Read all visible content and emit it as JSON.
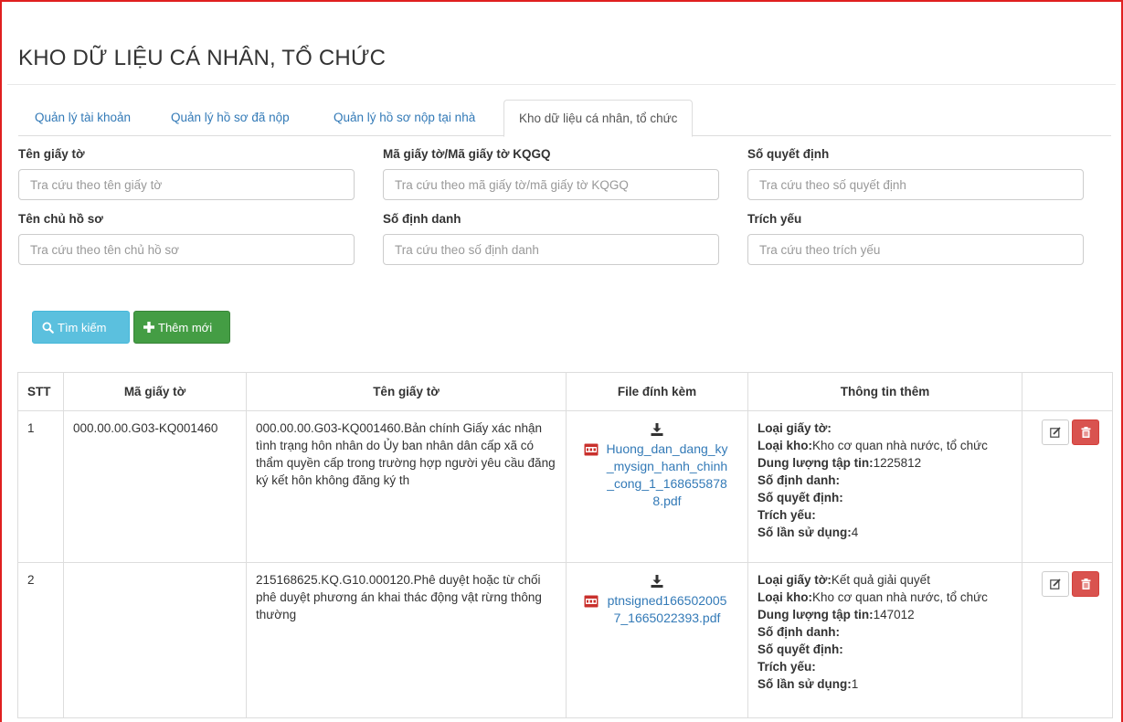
{
  "page": {
    "title": "KHO DỮ LIỆU CÁ NHÂN, TỔ CHỨC"
  },
  "tabs": [
    {
      "label": "Quản lý tài khoản",
      "active": false
    },
    {
      "label": "Quản lý hồ sơ đã nộp",
      "active": false
    },
    {
      "label": "Quản lý hồ sơ nộp tại nhà",
      "active": false
    },
    {
      "label": "Kho dữ liệu cá nhân, tổ chức",
      "active": true
    }
  ],
  "filters": {
    "ten_giay_to": {
      "label": "Tên giấy tờ",
      "value": "",
      "placeholder": "Tra cứu theo tên giấy tờ"
    },
    "ma_giay_to": {
      "label": "Mã giấy tờ/Mã giấy tờ KQGQ",
      "value": "",
      "placeholder": "Tra cứu theo mã giấy tờ/mã giấy tờ KQGQ"
    },
    "so_quyet_dinh": {
      "label": "Số quyết định",
      "value": "",
      "placeholder": "Tra cứu theo số quyết định"
    },
    "ten_chu_ho_so": {
      "label": "Tên chủ hồ sơ",
      "value": "",
      "placeholder": "Tra cứu theo tên chủ hồ sơ"
    },
    "so_dinh_danh": {
      "label": "Số định danh",
      "value": "",
      "placeholder": "Tra cứu theo số định danh"
    },
    "trich_yeu": {
      "label": "Trích yếu",
      "value": "",
      "placeholder": "Tra cứu theo trích yếu"
    }
  },
  "buttons": {
    "search_label": "Tìm kiếm",
    "add_label": "Thêm mới"
  },
  "colors": {
    "search": "#5bc0de",
    "add": "#449d44",
    "delete": "#d9534f",
    "link": "#337ab7",
    "frame": "#e02020"
  },
  "icons": {
    "search": "search-icon",
    "add": "plus-icon",
    "download": "download-icon",
    "pdf": "pdf-file-icon",
    "edit": "edit-icon",
    "delete": "trash-icon"
  },
  "table": {
    "headers": [
      "STT",
      "Mã giấy tờ",
      "Tên giấy tờ",
      "File đính kèm",
      "Thông tin thêm",
      ""
    ],
    "rows": [
      {
        "stt": "1",
        "ma_giay_to": "000.00.00.G03-KQ001460",
        "ten_giay_to": "000.00.00.G03-KQ001460.Bản chính Giấy xác nhận tình trạng hôn nhân do Ủy ban nhân dân cấp xã có thẩm quyền cấp trong trường hợp người yêu cầu đăng ký kết hôn không đăng ký th",
        "file": "Huong_dan_dang_ky_mysign_hanh_chinh_cong_1_1686558788.pdf",
        "info": {
          "loai_giay_to_label": "Loại giấy tờ:",
          "loai_giay_to": "",
          "loai_kho_label": "Loại kho:",
          "loai_kho": "Kho cơ quan nhà nước, tổ chức",
          "dung_luong_label": "Dung lượng tập tin:",
          "dung_luong": "1225812",
          "so_dinh_danh_label": "Số định danh:",
          "so_dinh_danh": "",
          "so_quyet_dinh_label": "Số quyết định:",
          "so_quyet_dinh": "",
          "trich_yeu_label": "Trích yếu:",
          "trich_yeu": "",
          "so_lan_label": "Số lần sử dụng:",
          "so_lan": "4"
        }
      },
      {
        "stt": "2",
        "ma_giay_to": "",
        "ten_giay_to": "215168625.KQ.G10.000120.Phê duyệt hoặc từ chối phê duyệt phương án khai thác động vật rừng thông thường",
        "file": "ptnsigned1665020057_1665022393.pdf",
        "info": {
          "loai_giay_to_label": "Loại giấy tờ:",
          "loai_giay_to": "Kết quả giải quyết",
          "loai_kho_label": "Loại kho:",
          "loai_kho": "Kho cơ quan nhà nước, tổ chức",
          "dung_luong_label": "Dung lượng tập tin:",
          "dung_luong": "147012",
          "so_dinh_danh_label": "Số định danh:",
          "so_dinh_danh": "",
          "so_quyet_dinh_label": "Số quyết định:",
          "so_quyet_dinh": "",
          "trich_yeu_label": "Trích yếu:",
          "trich_yeu": "",
          "so_lan_label": "Số lần sử dụng:",
          "so_lan": "1"
        }
      }
    ]
  }
}
